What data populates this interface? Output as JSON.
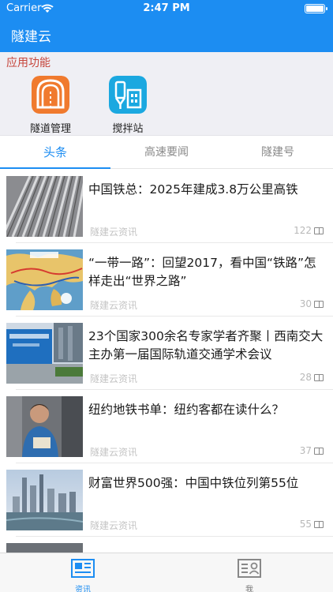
{
  "status_bar": {
    "carrier": "Carrier",
    "time": "2:47 PM"
  },
  "app": {
    "title": "隧建云"
  },
  "functions": {
    "section_title": "应用功能",
    "items": [
      {
        "label": "隧道管理",
        "icon": "tunnel-icon",
        "color": "#F07A2E"
      },
      {
        "label": "搅拌站",
        "icon": "mixing-station-icon",
        "color": "#1BA8E0"
      }
    ]
  },
  "tabs": [
    {
      "label": "头条",
      "active": true
    },
    {
      "label": "高速要闻",
      "active": false
    },
    {
      "label": "隧建号",
      "active": false
    }
  ],
  "news": [
    {
      "title": "中国铁总：2025年建成3.8万公里高铁",
      "source": "隧建云资讯",
      "views": "122"
    },
    {
      "title": "“一带一路”：回望2017，看中国“铁路”怎样走出“世界之路”",
      "source": "隧建云资讯",
      "views": "30"
    },
    {
      "title": "23个国家300余名专家学者齐聚丨西南交大主办第一届国际轨道交通学术会议",
      "source": "隧建云资讯",
      "views": "28"
    },
    {
      "title": "纽约地铁书单：纽约客都在读什么？",
      "source": "隧建云资讯",
      "views": "37"
    },
    {
      "title": "财富世界500强：中国中铁位列第55位",
      "source": "隧建云资讯",
      "views": "55"
    }
  ],
  "tabbar": [
    {
      "label": "资讯",
      "icon": "news-icon",
      "active": true
    },
    {
      "label": "我",
      "icon": "profile-card-icon",
      "active": false
    }
  ],
  "colors": {
    "primary": "#1C8DF2",
    "section_title": "#C6463C",
    "muted": "#C4C4C4"
  }
}
